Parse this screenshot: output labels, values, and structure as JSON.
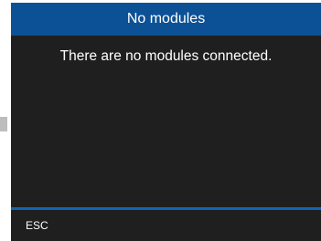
{
  "dialog": {
    "title": "No modules",
    "message": "There are no modules connected."
  },
  "footer": {
    "esc_label": "ESC"
  },
  "colors": {
    "title_bar": "#0c5195",
    "screen_background": "#1f1f1f",
    "divider": "#0f65b7",
    "text": "#ffffff"
  }
}
